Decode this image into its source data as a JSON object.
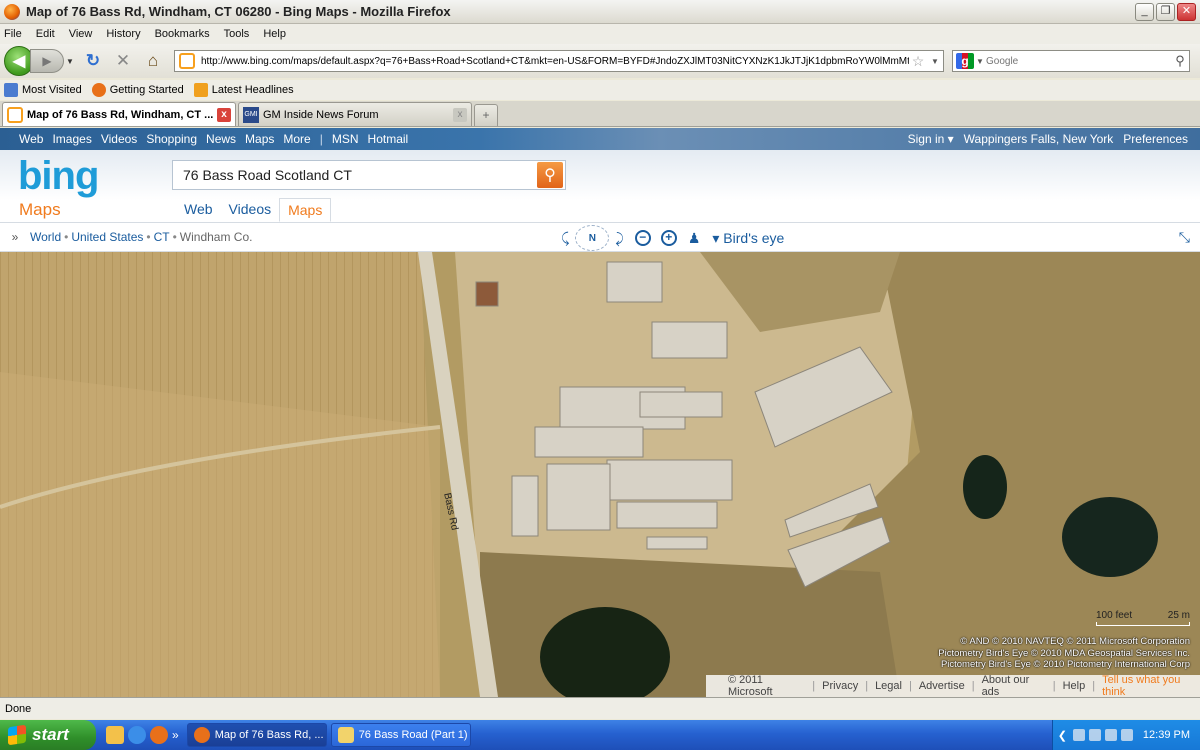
{
  "window": {
    "title": "Map of 76 Bass Rd, Windham, CT 06280 - Bing Maps - Mozilla Firefox",
    "controls": {
      "minimize": "_",
      "maximize": "❐",
      "close": "✕"
    }
  },
  "menu": [
    "File",
    "Edit",
    "View",
    "History",
    "Bookmarks",
    "Tools",
    "Help"
  ],
  "nav": {
    "url": "http://www.bing.com/maps/default.aspx?q=76+Bass+Road+Scotland+CT&mkt=en-US&FORM=BYFD#JndoZXJlMT03NitCYXNzK1JkJTJjK1dpbmRoYW0lMmMt",
    "search_placeholder": "Google",
    "icons": {
      "back": "◀",
      "forward": "▶",
      "reload": "↻",
      "stop": "✕",
      "home": "⌂",
      "star": "☆",
      "dropdown": "▼",
      "search": "⚲"
    }
  },
  "bookmarks": [
    {
      "label": "Most Visited",
      "color": "#4a7bd0"
    },
    {
      "label": "Getting Started",
      "color": "#e8701a"
    },
    {
      "label": "Latest Headlines",
      "color": "#f0a020"
    }
  ],
  "tabs": [
    {
      "label": "Map of 76 Bass Rd, Windham, CT ...",
      "active": true
    },
    {
      "label": "GM Inside News Forum",
      "active": false
    }
  ],
  "tab_icons": {
    "close": "x",
    "new_tab": "+"
  },
  "bing": {
    "topnav": [
      "Web",
      "Images",
      "Videos",
      "Shopping",
      "News",
      "Maps",
      "More"
    ],
    "topnav2": [
      "MSN",
      "Hotmail"
    ],
    "sign_in": "Sign in ▾",
    "location": "Wappingers Falls, New York",
    "preferences": "Preferences",
    "logo": "bing",
    "logo_sub": "Maps",
    "query": "76 Bass Road Scotland CT",
    "scopes": [
      "Web",
      "Videos",
      "Maps"
    ],
    "active_scope": "Maps",
    "breadcrumb": [
      "World",
      "United States",
      "CT",
      "Windham Co."
    ],
    "crumb_sep": "•",
    "view_mode": "▾ Bird's eye",
    "compass_label": "N",
    "controls": {
      "expand": "»",
      "rotate_left": "⤹",
      "rotate_right": "⤸",
      "zoom_out": "−",
      "zoom_in": "+",
      "person": "♟",
      "collapse": "⤡",
      "search": "⚲"
    }
  },
  "map": {
    "road_label": "Bass Rd",
    "scale": {
      "feet": "100 feet",
      "meters": "25 m"
    },
    "copyright": [
      "© AND  © 2010 NAVTEQ  © 2011 Microsoft Corporation",
      "Pictometry Bird's Eye © 2010 MDA Geospatial Services Inc.",
      "Pictometry Bird's Eye © 2010 Pictometry International Corp"
    ],
    "footer": [
      "© 2011 Microsoft",
      "Privacy",
      "Legal",
      "Advertise",
      "About our ads",
      "Help"
    ],
    "footer_highlight": "Tell us what you think",
    "footer_sep": "|"
  },
  "status": "Done",
  "taskbar": {
    "start": "start",
    "chevron": "»",
    "items": [
      {
        "label": "Map of 76 Bass Rd, ...",
        "active": true
      },
      {
        "label": "76 Bass Road (Part 1)",
        "active": false
      }
    ],
    "tray_arrow": "❮",
    "time": "12:39 PM"
  }
}
